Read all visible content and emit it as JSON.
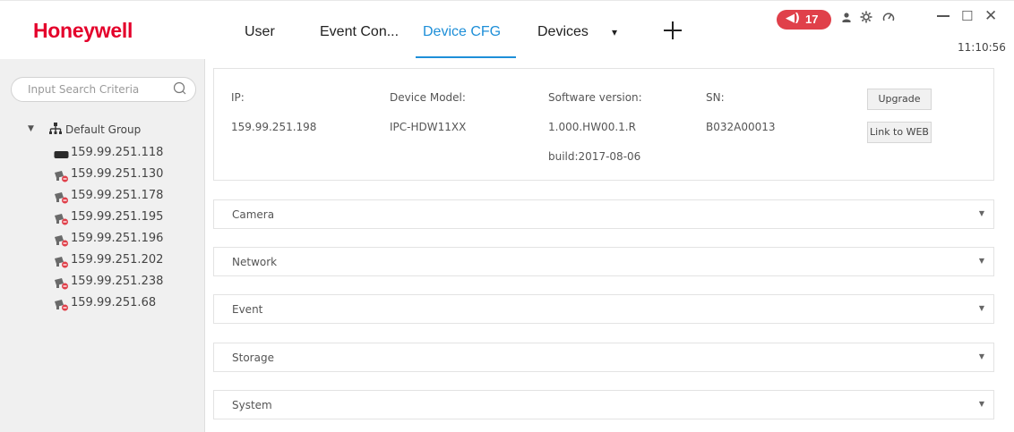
{
  "header": {
    "logo": "Honeywell",
    "tabs": [
      {
        "label": "User"
      },
      {
        "label": "Event Con..."
      },
      {
        "label": "Device CFG"
      },
      {
        "label": "Devices"
      }
    ],
    "dropdown_glyph": "▾",
    "alarm_count": "17",
    "clock": "11:10:56",
    "accent_color": "#1e8fd8",
    "alarm_color": "#e0404a",
    "brand_color": "#e4002b"
  },
  "sidebar": {
    "search_placeholder": "Input Search Criteria",
    "group_label": "Default Group",
    "devices": [
      {
        "label": "159.99.251.118",
        "icon": "nvr-icon"
      },
      {
        "label": "159.99.251.130",
        "icon": "offline-camera-icon"
      },
      {
        "label": "159.99.251.178",
        "icon": "offline-camera-icon"
      },
      {
        "label": "159.99.251.195",
        "icon": "offline-camera-icon"
      },
      {
        "label": "159.99.251.196",
        "icon": "offline-camera-icon"
      },
      {
        "label": "159.99.251.202",
        "icon": "offline-camera-icon"
      },
      {
        "label": "159.99.251.238",
        "icon": "offline-camera-icon"
      },
      {
        "label": "159.99.251.68",
        "icon": "offline-camera-icon"
      }
    ]
  },
  "device_info": {
    "ip_label": "IP:",
    "ip_value": "159.99.251.198",
    "model_label": "Device Model:",
    "model_value": "IPC-HDW11XX",
    "sw_label": "Software version:",
    "sw_value": "1.000.HW00.1.R",
    "sw_build": "build:2017-08-06",
    "sn_label": "SN:",
    "sn_value": "B032A00013",
    "upgrade_label": "Upgrade",
    "link_web_label": "Link to WEB"
  },
  "sections": [
    {
      "label": "Camera"
    },
    {
      "label": "Network"
    },
    {
      "label": "Event"
    },
    {
      "label": "Storage"
    },
    {
      "label": "System"
    }
  ]
}
